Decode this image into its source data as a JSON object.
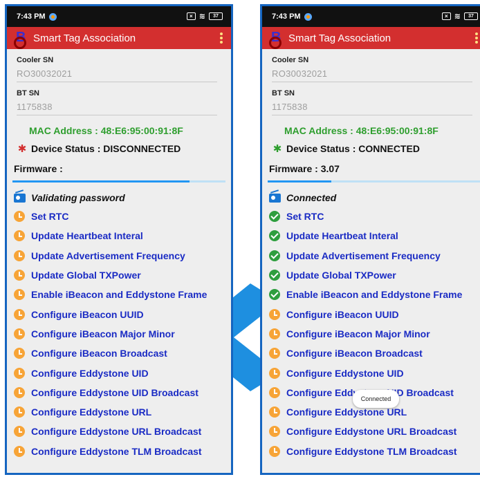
{
  "colors": {
    "frame": "#1565c0",
    "appbar": "#d32f2f",
    "mac": "#2e9e2e",
    "step_text": "#1a2bc4",
    "pending": "#f7a437",
    "done": "#2e9e3e"
  },
  "left": {
    "status_time": "7:43 PM",
    "battery": "37",
    "app_title": "Smart Tag Association",
    "cooler_label": "Cooler SN",
    "cooler_value": "RO30032021",
    "bt_label": "BT SN",
    "bt_value": "1175838",
    "mac": "MAC Address : 48:E6:95:00:91:8F",
    "device_status": "Device Status : DISCONNECTED",
    "bt_icon": "bluetooth-disabled-icon",
    "firmware": "Firmware :",
    "progress": 0.83,
    "header": "Validating password",
    "steps": [
      {
        "label": "Set RTC",
        "state": "pending"
      },
      {
        "label": "Update Heartbeat Interal",
        "state": "pending"
      },
      {
        "label": "Update Advertisement Frequency",
        "state": "pending"
      },
      {
        "label": "Update Global TXPower",
        "state": "pending"
      },
      {
        "label": "Enable iBeacon and Eddystone Frame",
        "state": "pending"
      },
      {
        "label": "Configure iBeacon UUID",
        "state": "pending"
      },
      {
        "label": "Configure iBeacon Major Minor",
        "state": "pending"
      },
      {
        "label": "Configure iBeacon Broadcast",
        "state": "pending"
      },
      {
        "label": "Configure Eddystone UID",
        "state": "pending"
      },
      {
        "label": "Configure Eddystone UID Broadcast",
        "state": "pending"
      },
      {
        "label": "Configure Eddystone URL",
        "state": "pending"
      },
      {
        "label": "Configure Eddystone URL Broadcast",
        "state": "pending"
      },
      {
        "label": "Configure Eddystone TLM Broadcast",
        "state": "pending"
      }
    ]
  },
  "right": {
    "status_time": "7:43 PM",
    "battery": "37",
    "app_title": "Smart Tag Association",
    "cooler_label": "Cooler SN",
    "cooler_value": "RO30032021",
    "bt_label": "BT SN",
    "bt_value": "1175838",
    "mac": "MAC Address : 48:E6:95:00:91:8F",
    "device_status": "Device Status : CONNECTED",
    "bt_icon": "bluetooth-connected-icon",
    "firmware": "Firmware : 3.07",
    "progress": 0.3,
    "header": "Connected",
    "toast": "Connected",
    "steps": [
      {
        "label": "Set RTC",
        "state": "done"
      },
      {
        "label": "Update Heartbeat Interal",
        "state": "done"
      },
      {
        "label": "Update Advertisement Frequency",
        "state": "done"
      },
      {
        "label": "Update Global TXPower",
        "state": "done"
      },
      {
        "label": "Enable iBeacon and Eddystone Frame",
        "state": "done"
      },
      {
        "label": "Configure iBeacon UUID",
        "state": "pending"
      },
      {
        "label": "Configure iBeacon Major Minor",
        "state": "pending"
      },
      {
        "label": "Configure iBeacon Broadcast",
        "state": "pending"
      },
      {
        "label": "Configure Eddystone UID",
        "state": "pending"
      },
      {
        "label": "Configure Eddystone UID Broadcast",
        "state": "pending"
      },
      {
        "label": "Configure Eddystone URL",
        "state": "pending"
      },
      {
        "label": "Configure Eddystone URL Broadcast",
        "state": "pending"
      },
      {
        "label": "Configure Eddystone TLM Broadcast",
        "state": "pending"
      }
    ]
  }
}
